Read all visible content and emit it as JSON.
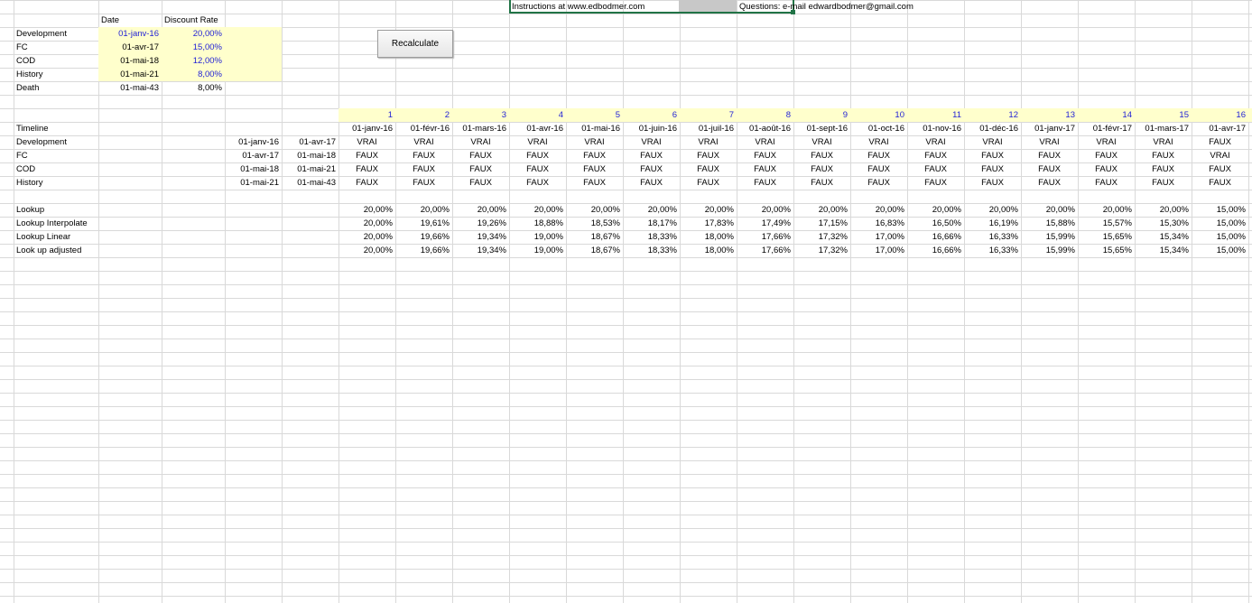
{
  "header": {
    "instructions": "Instructions at www.edbodmer.com",
    "questions": "Questions: e-mail edwardbodmer@gmail.com"
  },
  "button": {
    "label": "Recalculate"
  },
  "rates_table": {
    "col_date": "Date",
    "col_rate": "Discount Rate",
    "rows": [
      {
        "name": "Development",
        "date": "01-janv-16",
        "rate": "20,00%"
      },
      {
        "name": "FC",
        "date": "01-avr-17",
        "rate": "15,00%"
      },
      {
        "name": "COD",
        "date": "01-mai-18",
        "rate": "12,00%"
      },
      {
        "name": "History",
        "date": "01-mai-21",
        "rate": "8,00%"
      },
      {
        "name": "Death",
        "date": "01-mai-43",
        "rate": "8,00%"
      }
    ]
  },
  "timeline": {
    "label": "Timeline",
    "periods": [
      "1",
      "2",
      "3",
      "4",
      "5",
      "6",
      "7",
      "8",
      "9",
      "10",
      "11",
      "12",
      "13",
      "14",
      "15",
      "16"
    ],
    "dates": [
      "01-janv-16",
      "01-févr-16",
      "01-mars-16",
      "01-avr-16",
      "01-mai-16",
      "01-juin-16",
      "01-juil-16",
      "01-août-16",
      "01-sept-16",
      "01-oct-16",
      "01-nov-16",
      "01-déc-16",
      "01-janv-17",
      "01-févr-17",
      "01-mars-17",
      "01-avr-17"
    ],
    "phases": [
      {
        "name": "Development",
        "start": "01-janv-16",
        "end": "01-avr-17",
        "flags": [
          "VRAI",
          "VRAI",
          "VRAI",
          "VRAI",
          "VRAI",
          "VRAI",
          "VRAI",
          "VRAI",
          "VRAI",
          "VRAI",
          "VRAI",
          "VRAI",
          "VRAI",
          "VRAI",
          "VRAI",
          "FAUX"
        ]
      },
      {
        "name": "FC",
        "start": "01-avr-17",
        "end": "01-mai-18",
        "flags": [
          "FAUX",
          "FAUX",
          "FAUX",
          "FAUX",
          "FAUX",
          "FAUX",
          "FAUX",
          "FAUX",
          "FAUX",
          "FAUX",
          "FAUX",
          "FAUX",
          "FAUX",
          "FAUX",
          "FAUX",
          "VRAI"
        ]
      },
      {
        "name": "COD",
        "start": "01-mai-18",
        "end": "01-mai-21",
        "flags": [
          "FAUX",
          "FAUX",
          "FAUX",
          "FAUX",
          "FAUX",
          "FAUX",
          "FAUX",
          "FAUX",
          "FAUX",
          "FAUX",
          "FAUX",
          "FAUX",
          "FAUX",
          "FAUX",
          "FAUX",
          "FAUX"
        ]
      },
      {
        "name": "History",
        "start": "01-mai-21",
        "end": "01-mai-43",
        "flags": [
          "FAUX",
          "FAUX",
          "FAUX",
          "FAUX",
          "FAUX",
          "FAUX",
          "FAUX",
          "FAUX",
          "FAUX",
          "FAUX",
          "FAUX",
          "FAUX",
          "FAUX",
          "FAUX",
          "FAUX",
          "FAUX"
        ]
      }
    ]
  },
  "lookups": [
    {
      "name": "Lookup",
      "values": [
        "20,00%",
        "20,00%",
        "20,00%",
        "20,00%",
        "20,00%",
        "20,00%",
        "20,00%",
        "20,00%",
        "20,00%",
        "20,00%",
        "20,00%",
        "20,00%",
        "20,00%",
        "20,00%",
        "20,00%",
        "15,00%"
      ]
    },
    {
      "name": "Lookup Interpolate",
      "values": [
        "20,00%",
        "19,61%",
        "19,26%",
        "18,88%",
        "18,53%",
        "18,17%",
        "17,83%",
        "17,49%",
        "17,15%",
        "16,83%",
        "16,50%",
        "16,19%",
        "15,88%",
        "15,57%",
        "15,30%",
        "15,00%"
      ]
    },
    {
      "name": "Lookup Linear",
      "values": [
        "20,00%",
        "19,66%",
        "19,34%",
        "19,00%",
        "18,67%",
        "18,33%",
        "18,00%",
        "17,66%",
        "17,32%",
        "17,00%",
        "16,66%",
        "16,33%",
        "15,99%",
        "15,65%",
        "15,34%",
        "15,00%"
      ]
    },
    {
      "name": "Look up adjusted",
      "values": [
        "20,00%",
        "19,66%",
        "19,34%",
        "19,00%",
        "18,67%",
        "18,33%",
        "18,00%",
        "17,66%",
        "17,32%",
        "17,00%",
        "16,66%",
        "16,33%",
        "15,99%",
        "15,65%",
        "15,34%",
        "15,00%"
      ]
    }
  ],
  "colors": {
    "input_fill": "#ffffcc",
    "input_text": "#1f1fd6",
    "gridline": "#d9d9d9",
    "selection": "#217346"
  }
}
